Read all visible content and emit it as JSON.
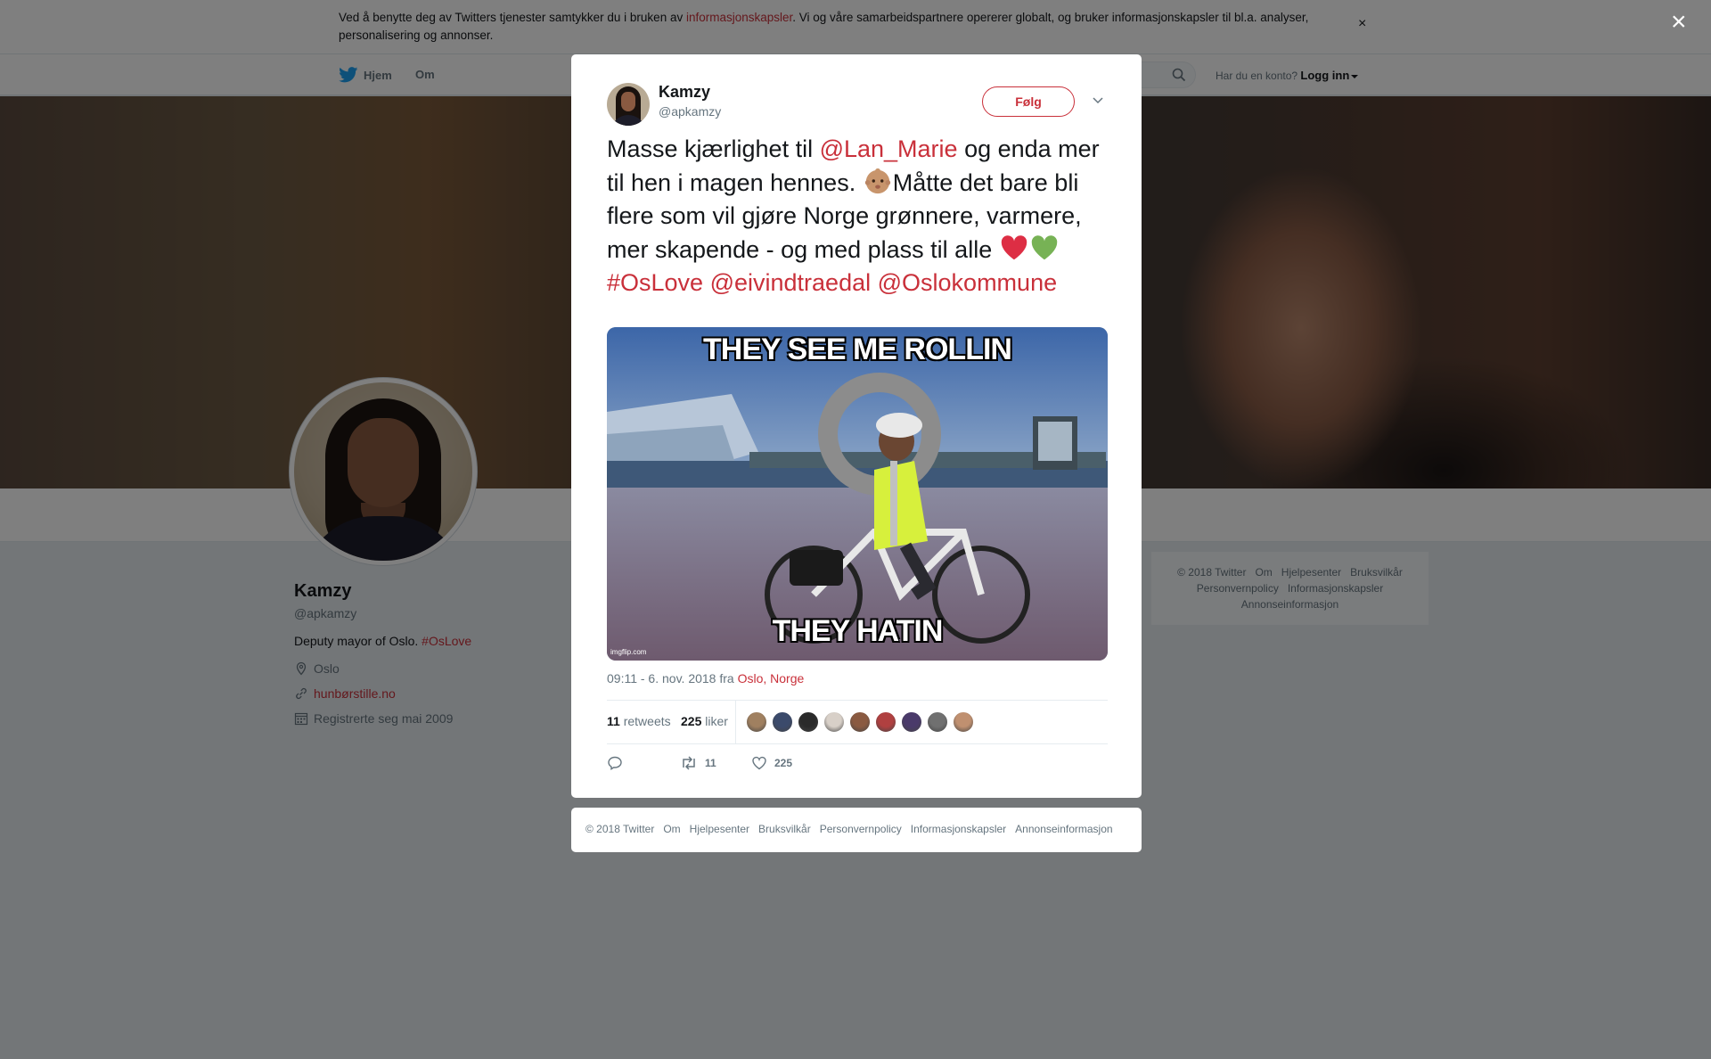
{
  "cookie_bar": {
    "text_before": "Ved å benytte deg av Twitters tjenester samtykker du i bruken av ",
    "link": "informasjonskapsler",
    "text_after": ". Vi og våre samarbeidspartnere opererer globalt, og bruker informasjonskapsler til bl.a. analyser, personalisering og annonser.",
    "close_label": "×"
  },
  "nav": {
    "home": "Hjem",
    "about": "Om",
    "account_prompt": "Har du en konto?",
    "login": "Logg inn"
  },
  "profile": {
    "name": "Kamzy",
    "handle": "@apkamzy",
    "bio_text": "Deputy mayor of Oslo. ",
    "bio_hashtag": "#OsLove",
    "location": "Oslo",
    "website": "hunbørstille.no",
    "joined": "Registrerte seg mai 2009"
  },
  "side_footer": {
    "items": [
      "© 2018 Twitter",
      "Om",
      "Hjelpesenter",
      "Bruksvilkår",
      "Personvernpolicy",
      "Informasjonskapsler",
      "Annonseinformasjon"
    ]
  },
  "overlay": {
    "close_label": "×"
  },
  "tweet": {
    "author_name": "Kamzy",
    "author_handle": "@apkamzy",
    "follow_label": "Følg",
    "text": {
      "part1": "Masse kjærlighet til ",
      "mention1": "@Lan_Marie",
      "part2": " og enda mer til hen i magen hennes. ",
      "part3": "Måtte det bare bli flere som vil gjøre Norge grønnere, varmere, mer skapende - og med plass til alle ",
      "hashtag": "#OsLove",
      "mention2": "@eivindtraedal",
      "mention3": "@Oslokommune"
    },
    "media": {
      "caption_top": "THEY SEE ME ROLLIN",
      "caption_bottom": "THEY HATIN",
      "watermark": "imgflip.com"
    },
    "time": "09:11 - 6. nov. 2018 fra ",
    "place": "Oslo, Norge",
    "retweets_count": "11",
    "retweets_label": "retweets",
    "likes_count": "225",
    "likes_label": "liker",
    "liker_colors": [
      "#a08060",
      "#3b4a6b",
      "#2a2a2a",
      "#d8d0c8",
      "#8a5a41",
      "#b04040",
      "#4a3a6a",
      "#707070",
      "#c09070"
    ],
    "action_retweet_count": "11",
    "action_like_count": "225"
  },
  "modal_footer": {
    "items": [
      "© 2018 Twitter",
      "Om",
      "Hjelpesenter",
      "Bruksvilkår",
      "Personvernpolicy",
      "Informasjonskapsler",
      "Annonseinformasjon"
    ]
  },
  "colors": {
    "accent": "#c9303a",
    "nav_icon": "#1da1f2",
    "muted": "#66757f"
  }
}
